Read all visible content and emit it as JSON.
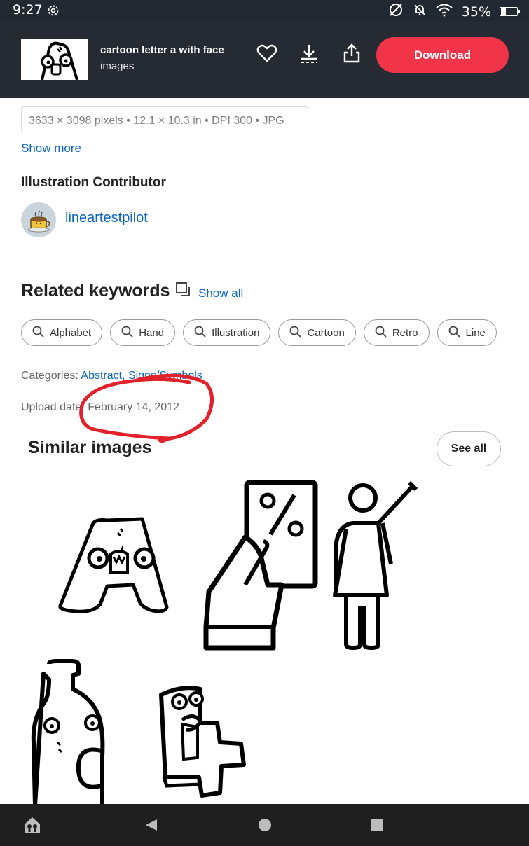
{
  "status": {
    "time": "9:27",
    "battery": "35%",
    "battery_level": 0.35,
    "icons": [
      "settings-gear-icon",
      "no-sync-icon",
      "bell-off-icon",
      "wifi-icon",
      "battery-icon"
    ]
  },
  "header": {
    "title": "cartoon letter a with face",
    "subtitle": "images",
    "download_label": "Download",
    "icons": [
      "favorite-heart-icon",
      "download-arrow-icon",
      "share-icon"
    ],
    "accent_color": "#f13448"
  },
  "details": {
    "dimensions": "3633 × 3098 pixels • 12.1 × 10.3 in • DPI 300 • JPG",
    "show_more": "Show more"
  },
  "contributor": {
    "heading": "Illustration Contributor",
    "name": "lineartestpilot"
  },
  "keywords": {
    "heading": "Related keywords",
    "show_all": "Show all",
    "items": [
      "Alphabet",
      "Hand",
      "Illustration",
      "Cartoon",
      "Retro",
      "Line"
    ]
  },
  "meta": {
    "categories_label": "Categories:",
    "categories_value": "Abstract, Signs/Symbols",
    "upload_label": "Upload date:",
    "upload_value": "February 14, 2012"
  },
  "similar": {
    "heading": "Similar images",
    "see_all": "See all",
    "images": [
      "cartoon-letter-a-face",
      "hand-holding-discount-phone",
      "woman-raising-hand",
      "bottle-with-face",
      "cartoon-number-four"
    ]
  },
  "navbar": {
    "icons": [
      "home-app-icon",
      "back-triangle-icon",
      "home-circle-icon",
      "recents-square-icon"
    ]
  }
}
